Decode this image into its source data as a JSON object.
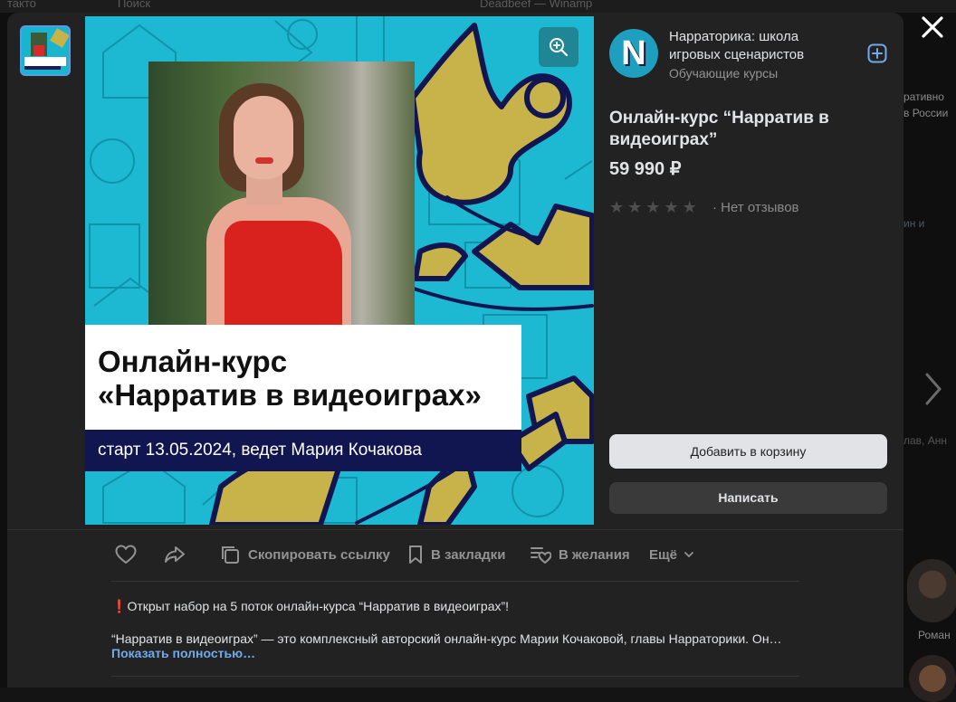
{
  "background": {
    "topbar_left": "такто",
    "topbar_search": "Поиск",
    "topbar_player": "Deadbeef — Winamp",
    "right_snippets": [
      "ративно",
      "в России",
      "ин и",
      "лав, Анн"
    ],
    "right_person_name": "Роман"
  },
  "seller": {
    "name": "Нарраторика: школа игровых сценаристов",
    "category": "Обучающие курсы",
    "avatar_letter": "N"
  },
  "product": {
    "title": "Онлайн-курс “Нарратив в видеоиграх”",
    "price": "59 990 ₽",
    "rating_stars": 0,
    "rating_max": 5,
    "reviews_text": "· Нет отзывов"
  },
  "image": {
    "title_line": "Онлайн-курс\n«Нарратив в видеоиграх»",
    "subtitle": "старт 13.05.2024, ведет Мария Кочакова",
    "thumb_title": "Онлайн-курс «Нарратив в видеоиграх»"
  },
  "buttons": {
    "add_to_cart": "Добавить в корзину",
    "write": "Написать"
  },
  "actions": {
    "copy_link": "Скопировать ссылку",
    "bookmarks": "В закладки",
    "wishlist": "В желания",
    "more": "Ещё"
  },
  "description": {
    "line1_mark": "❗",
    "line1": "Открыт набор на 5 поток онлайн-курса “Нарратив в видеоиграх”!",
    "line2": "“Нарратив в видеоиграх” — это комплексный авторский онлайн-курс Марии Кочаковой, главы Нарраторики. Он…",
    "show_more": "Показать полностью…"
  },
  "icons": {
    "close": "close-icon",
    "zoom": "zoom-in-icon",
    "follow": "add-square-icon",
    "like": "heart-icon",
    "share": "share-arrow-icon",
    "copy": "copy-icon",
    "bookmark": "bookmark-icon",
    "wishlist": "wishlist-icon",
    "next": "chevron-right-icon"
  },
  "colors": {
    "image_cyan": "#1db8d1",
    "bird_gold": "#c7b34a",
    "navy": "#121650",
    "link": "#71aaeb"
  }
}
